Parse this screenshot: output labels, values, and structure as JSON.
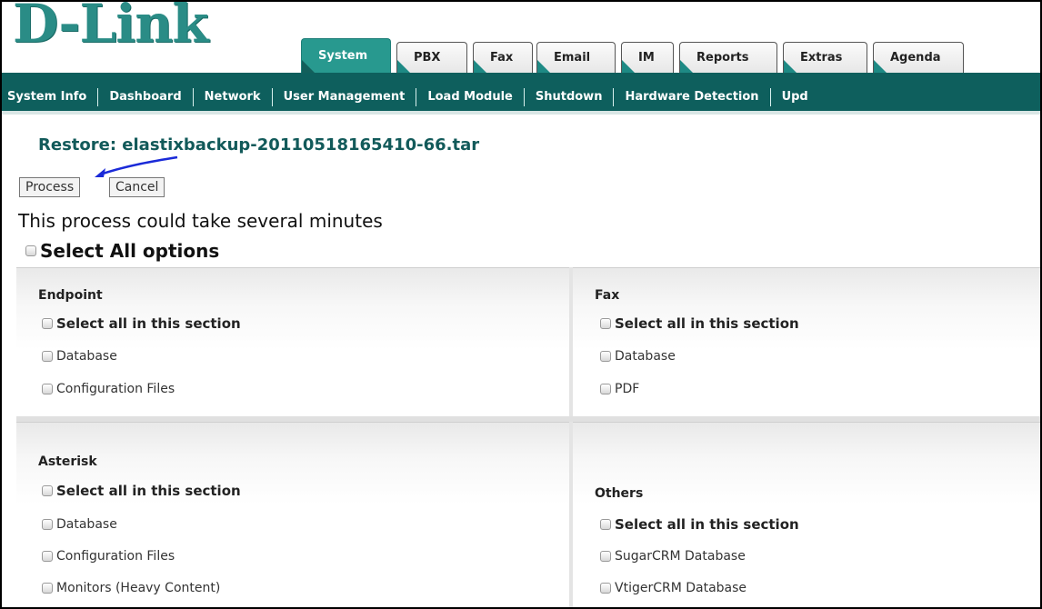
{
  "header": {
    "logo": "D-Link"
  },
  "tabs": [
    {
      "label": "System",
      "active": true
    },
    {
      "label": "PBX"
    },
    {
      "label": "Fax"
    },
    {
      "label": "Email"
    },
    {
      "label": "IM"
    },
    {
      "label": "Reports"
    },
    {
      "label": "Extras"
    },
    {
      "label": "Agenda"
    }
  ],
  "subnav": [
    "System Info",
    "Dashboard",
    "Network",
    "User Management",
    "Load Module",
    "Shutdown",
    "Hardware Detection",
    "Upd"
  ],
  "page": {
    "restore_title": "Restore: elastixbackup-20110518165410-66.tar",
    "process_button": "Process",
    "cancel_button": "Cancel",
    "note": "This process could take several minutes",
    "select_all": "Select All options"
  },
  "sections": {
    "endpoint": {
      "title": "Endpoint",
      "select_all": "Select all in this section",
      "options": [
        "Database",
        "Configuration Files"
      ]
    },
    "fax": {
      "title": "Fax",
      "select_all": "Select all in this section",
      "options": [
        "Database",
        "PDF"
      ]
    },
    "asterisk": {
      "title": "Asterisk",
      "select_all": "Select all in this section",
      "options": [
        "Database",
        "Configuration Files",
        "Monitors (Heavy Content)"
      ]
    },
    "others": {
      "title": "Others",
      "select_all": "Select all in this section",
      "options": [
        "SugarCRM Database",
        "VtigerCRM Database"
      ]
    }
  },
  "colors": {
    "brand": "#28998f",
    "nav": "#0e5f5d",
    "title": "#125a5a",
    "arrow": "#1a2ad8"
  }
}
